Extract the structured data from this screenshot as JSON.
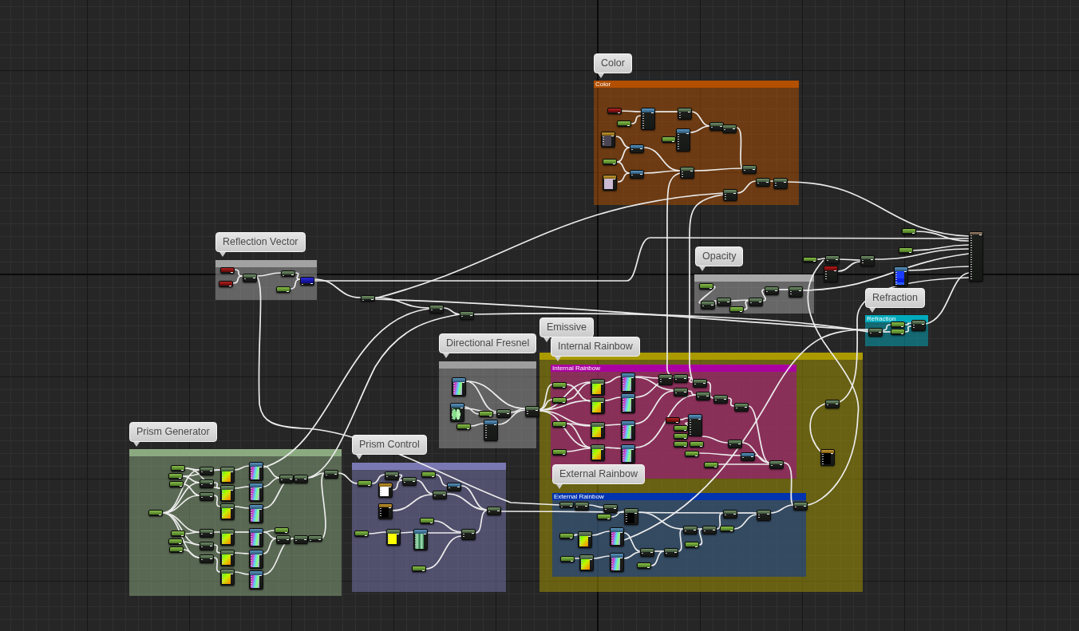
{
  "graph": {
    "comments": [
      {
        "title": "Color",
        "header": "Color",
        "color": "#b24f00"
      },
      {
        "title": "Reflection Vector",
        "color": "#a2a2a2"
      },
      {
        "title": "Opacity",
        "color": "#a8a8a8"
      },
      {
        "title": "Refraction",
        "header": "Refraction",
        "color": "#00aabb"
      },
      {
        "title": "Directional Fresnel",
        "color": "#9e9e9e"
      },
      {
        "title": "Emissive",
        "color": "#aa9a00"
      },
      {
        "title": "Internal Rainbow",
        "header": "Internal Rainbow",
        "color": "#aa00a0"
      },
      {
        "title": "Prism Generator",
        "color": "#8caa80"
      },
      {
        "title": "Prism Control",
        "color": "#7a78b2"
      },
      {
        "title": "External Rainbow",
        "header": "External Rainbow",
        "color": "#0033b0"
      }
    ]
  }
}
